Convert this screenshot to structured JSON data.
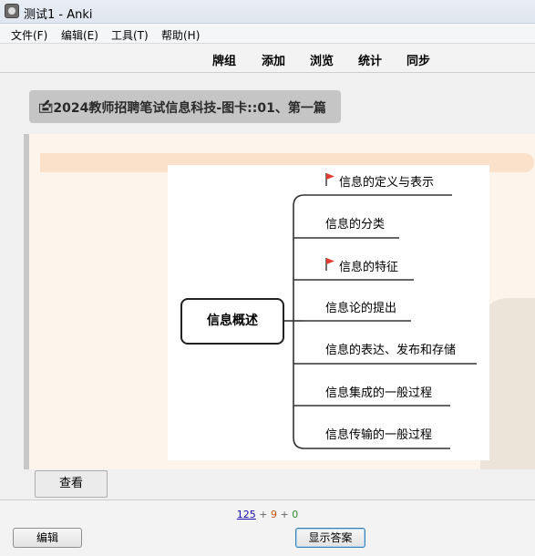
{
  "window": {
    "title": "测试1 - Anki"
  },
  "menubar": {
    "items": [
      "文件(F)",
      "编辑(E)",
      "工具(T)",
      "帮助(H)"
    ]
  },
  "toolbar": {
    "items": [
      "牌组",
      "添加",
      "浏览",
      "统计",
      "同步"
    ]
  },
  "deck": {
    "title": "🖆2024教师招聘笔试信息科技-图卡::01、第一篇"
  },
  "mindmap": {
    "central": "信息概述",
    "branches": [
      {
        "label": "信息的定义与表示",
        "flagged": true
      },
      {
        "label": "信息的分类",
        "flagged": false
      },
      {
        "label": "信息的特征",
        "flagged": true
      },
      {
        "label": "信息论的提出",
        "flagged": false
      },
      {
        "label": "信息的表达、发布和存储",
        "flagged": false
      },
      {
        "label": "信息集成的一般过程",
        "flagged": false
      },
      {
        "label": "信息传输的一般过程",
        "flagged": false
      }
    ],
    "flag_color": "#e03b2f"
  },
  "card_buttons": {
    "reveal": "查看"
  },
  "counts": {
    "new": "125",
    "sep1": "+",
    "learn": "9",
    "sep2": "+",
    "review": "0"
  },
  "bottom": {
    "edit": "编辑",
    "show_answer": "显示答案"
  }
}
